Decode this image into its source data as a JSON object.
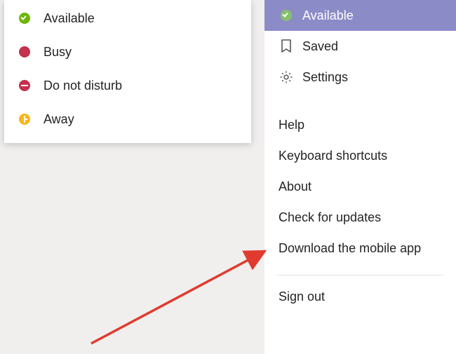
{
  "status_submenu": {
    "items": [
      {
        "key": "available",
        "label": "Available"
      },
      {
        "key": "busy",
        "label": "Busy"
      },
      {
        "key": "dnd",
        "label": "Do not disturb"
      },
      {
        "key": "away",
        "label": "Away"
      }
    ]
  },
  "right_menu": {
    "current_status": {
      "key": "available",
      "label": "Available"
    },
    "primary": [
      {
        "icon": "bookmark",
        "label": "Saved"
      },
      {
        "icon": "gear",
        "label": "Settings"
      }
    ],
    "secondary": [
      {
        "label": "Help"
      },
      {
        "label": "Keyboard shortcuts"
      },
      {
        "label": "About"
      },
      {
        "label": "Check for updates"
      },
      {
        "label": "Download the mobile app"
      }
    ],
    "footer": [
      {
        "label": "Sign out"
      }
    ]
  },
  "annotation": {
    "arrow_target": "Check for updates"
  },
  "colors": {
    "highlight_bg": "#8b8cc7",
    "highlight_fg": "#ffffff",
    "presence_available": "#6bb700",
    "presence_busy": "#c4314b",
    "presence_away": "#f9b716",
    "arrow": "#e03b2e"
  }
}
